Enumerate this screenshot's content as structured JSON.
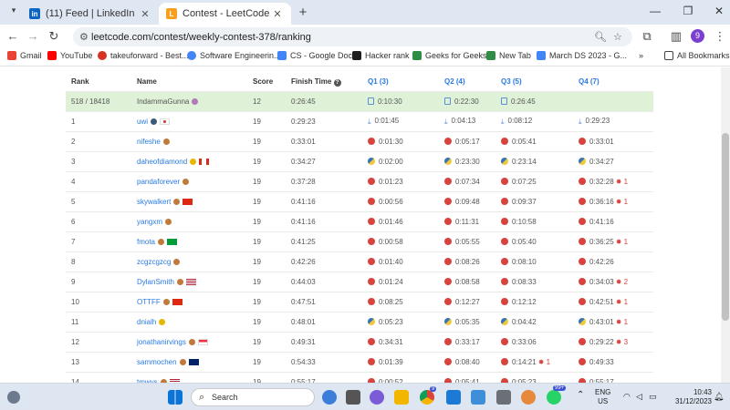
{
  "browser": {
    "tabs": [
      {
        "title": "(11) Feed | LinkedIn",
        "favicon": "linkedin-icon",
        "color": "#0a66c2"
      },
      {
        "title": "Contest - LeetCode",
        "favicon": "leetcode-icon",
        "color": "#f89f1b"
      }
    ],
    "url": "leetcode.com/contest/weekly-contest-378/ranking",
    "profile_initial": "9",
    "bookmarks": [
      {
        "label": "Gmail",
        "color": "#ea4335"
      },
      {
        "label": "YouTube",
        "color": "#ff0000"
      },
      {
        "label": "takeuforward - Best...",
        "color": "#d93025"
      },
      {
        "label": "Software Engineerin...",
        "color": "#4285f4"
      },
      {
        "label": "CS - Google Docs",
        "color": "#4285f4"
      },
      {
        "label": "Hacker rank",
        "color": "#1e1e1e"
      },
      {
        "label": "Geeks for Geeks",
        "color": "#2f8d46"
      },
      {
        "label": "New Tab",
        "color": "#2f8d46"
      },
      {
        "label": "March DS 2023 - G...",
        "color": "#4285f4"
      },
      {
        "label": "All Bookmarks",
        "color": "#444444"
      }
    ]
  },
  "ranking": {
    "headers": [
      "Rank",
      "Name",
      "Score",
      "Finish Time",
      "Q1 (3)",
      "Q2 (4)",
      "Q3 (5)",
      "Q4 (7)"
    ],
    "self": {
      "rank": "518 / 18418",
      "name": "IndammaGunna",
      "score": "12",
      "finish": "0:26:45",
      "q1": "0:10:30",
      "q2": "0:22:30",
      "q3": "0:26:45",
      "q4": ""
    },
    "rows": [
      {
        "rank": "1",
        "name": "uwi",
        "score": "19",
        "finish": "0:29:23",
        "q1": "0:01:45",
        "q2": "0:04:13",
        "q3": "0:08:12",
        "q4": "0:29:23",
        "lang": "dl",
        "flag": "jp",
        "q4bug": ""
      },
      {
        "rank": "2",
        "name": "nifeshe",
        "score": "19",
        "finish": "0:33:01",
        "q1": "0:01:30",
        "q2": "0:05:17",
        "q3": "0:05:41",
        "q4": "0:33:01",
        "lang": "cpp",
        "flag": "",
        "q4bug": ""
      },
      {
        "rank": "3",
        "name": "daheofdiamond",
        "score": "19",
        "finish": "0:34:27",
        "q1": "0:02:00",
        "q2": "0:23:30",
        "q3": "0:23:14",
        "q4": "0:34:27",
        "lang": "py",
        "flag": "ca",
        "q4bug": ""
      },
      {
        "rank": "4",
        "name": "pandaforever",
        "score": "19",
        "finish": "0:37:28",
        "q1": "0:01:23",
        "q2": "0:07:34",
        "q3": "0:07:25",
        "q4": "0:32:28",
        "lang": "cpp",
        "flag": "",
        "q4bug": "1"
      },
      {
        "rank": "5",
        "name": "skywalkert",
        "score": "19",
        "finish": "0:41:16",
        "q1": "0:00:56",
        "q2": "0:09:48",
        "q3": "0:09:37",
        "q4": "0:36:16",
        "lang": "cpp",
        "flag": "cn",
        "q4bug": "1"
      },
      {
        "rank": "6",
        "name": "yangxm",
        "score": "19",
        "finish": "0:41:16",
        "q1": "0:01:46",
        "q2": "0:11:31",
        "q3": "0:10:58",
        "q4": "0:41:16",
        "lang": "cpp",
        "flag": "",
        "q4bug": ""
      },
      {
        "rank": "7",
        "name": "fmota",
        "score": "19",
        "finish": "0:41:25",
        "q1": "0:00:58",
        "q2": "0:05:55",
        "q3": "0:05:40",
        "q4": "0:36:25",
        "lang": "cpp",
        "flag": "br",
        "q4bug": "1"
      },
      {
        "rank": "8",
        "name": "zcgzcgzcg",
        "score": "19",
        "finish": "0:42:26",
        "q1": "0:01:40",
        "q2": "0:08:26",
        "q3": "0:08:10",
        "q4": "0:42:26",
        "lang": "cpp",
        "flag": "",
        "q4bug": ""
      },
      {
        "rank": "9",
        "name": "DylanSmith",
        "score": "19",
        "finish": "0:44:03",
        "q1": "0:01:24",
        "q2": "0:08:58",
        "q3": "0:08:33",
        "q4": "0:34:03",
        "lang": "cpp",
        "flag": "us",
        "q4bug": "2"
      },
      {
        "rank": "10",
        "name": "OTTFF",
        "score": "19",
        "finish": "0:47:51",
        "q1": "0:08:25",
        "q2": "0:12:27",
        "q3": "0:12:12",
        "q4": "0:42:51",
        "lang": "cpp",
        "flag": "cn",
        "q4bug": "1"
      },
      {
        "rank": "11",
        "name": "dnialh",
        "score": "19",
        "finish": "0:48:01",
        "q1": "0:05:23",
        "q2": "0:05:35",
        "q3": "0:04:42",
        "q4": "0:43:01",
        "lang": "py",
        "flag": "",
        "q4bug": "1"
      },
      {
        "rank": "12",
        "name": "jonathanirvings",
        "score": "19",
        "finish": "0:49:31",
        "q1": "0:34:31",
        "q2": "0:33:17",
        "q3": "0:33:06",
        "q4": "0:29:22",
        "lang": "cpp",
        "flag": "sg",
        "q4bug": "3"
      },
      {
        "rank": "13",
        "name": "sammochen",
        "score": "19",
        "finish": "0:54:33",
        "q1": "0:01:39",
        "q2": "0:08:40",
        "q3": "0:14:21",
        "q4": "0:49:33",
        "lang": "cpp",
        "flag": "au",
        "q4bug": "",
        "q3bug": "1"
      },
      {
        "rank": "14",
        "name": "tmwys",
        "score": "19",
        "finish": "0:55:17",
        "q1": "0:00:52",
        "q2": "0:05:41",
        "q3": "0:05:23",
        "q4": "0:55:17",
        "lang": "cpp",
        "flag": "us",
        "q4bug": ""
      }
    ]
  },
  "taskbar": {
    "search_label": "Search",
    "chrome_badge": "9",
    "whatsapp_badge": "99+",
    "lang": "ENG",
    "region": "US",
    "time": "10:43",
    "date": "31/12/2023"
  }
}
